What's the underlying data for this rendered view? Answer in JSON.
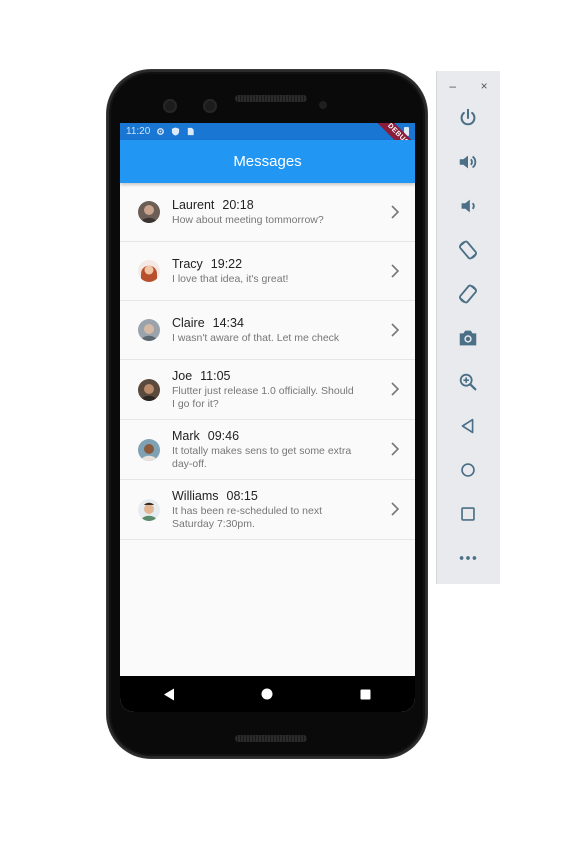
{
  "status_bar": {
    "time": "11:20",
    "debug_banner": "DEBUG",
    "icons": [
      "gear-icon",
      "shield-icon",
      "sim-card-icon",
      "battery-icon"
    ]
  },
  "app_bar": {
    "title": "Messages"
  },
  "messages": [
    {
      "name": "Laurent",
      "time": "20:18",
      "text": "How about meeting tommorrow?"
    },
    {
      "name": "Tracy",
      "time": "19:22",
      "text": "I love that idea, it's great!"
    },
    {
      "name": "Claire",
      "time": "14:34",
      "text": "I wasn't aware of that. Let me check"
    },
    {
      "name": "Joe",
      "time": "11:05",
      "text": "Flutter just release 1.0 officially. Should I go for it?"
    },
    {
      "name": "Mark",
      "time": "09:46",
      "text": "It totally makes sens to get some extra day-off."
    },
    {
      "name": "Williams",
      "time": "08:15",
      "text": "It has been re-scheduled to next Saturday 7:30pm."
    }
  ],
  "nav_bar": {
    "buttons": [
      "back-icon",
      "home-icon",
      "recents-icon"
    ]
  },
  "emulator_panel": {
    "window_controls": {
      "minimize": "–",
      "close": "×"
    },
    "tools": [
      "power-icon",
      "volume-up-icon",
      "volume-down-icon",
      "rotate-left-icon",
      "rotate-right-icon",
      "camera-icon",
      "zoom-icon",
      "back-icon",
      "home-icon",
      "overview-icon",
      "more-icon"
    ]
  },
  "colors": {
    "primary": "#2196F3",
    "status_bar": "#1976D2",
    "panel_icon": "#4a6f87"
  }
}
